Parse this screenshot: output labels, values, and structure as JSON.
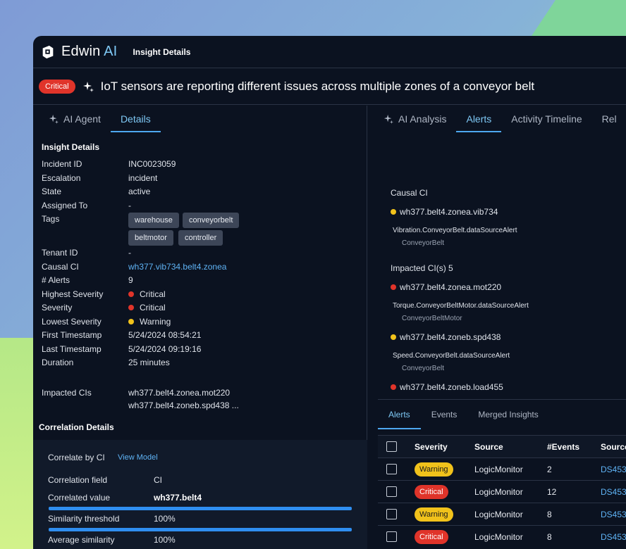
{
  "app": {
    "brand_prefix": "Edwin",
    "brand_suffix": "AI",
    "page_title": "Insight Details"
  },
  "headline": {
    "severity": "Critical",
    "text": "IoT sensors are reporting different issues across multiple zones of a conveyor belt"
  },
  "left_tabs": [
    "AI Agent",
    "Details"
  ],
  "details": {
    "section_title": "Insight Details",
    "incident_id_label": "Incident ID",
    "incident_id": "INC0023059",
    "escalation_label": "Escalation",
    "escalation": "incident",
    "state_label": "State",
    "state": "active",
    "assigned_label": "Assigned To",
    "assigned": "-",
    "tags_label": "Tags",
    "tags": [
      "warehouse",
      "conveyorbelt",
      "beltmotor",
      "controller"
    ],
    "tenant_label": "Tenant ID",
    "tenant": "-",
    "causal_ci_label": "Causal CI",
    "causal_ci": "wh377.vib734.belt4.zonea",
    "alerts_label": "# Alerts",
    "alerts": "9",
    "highest_sev_label": "Highest Severity",
    "highest_sev": "Critical",
    "severity_label": "Severity",
    "severity": "Critical",
    "lowest_sev_label": "Lowest Severity",
    "lowest_sev": "Warning",
    "first_ts_label": "First Timestamp",
    "first_ts": "5/24/2024 08:54:21",
    "last_ts_label": "Last Timestamp",
    "last_ts": "5/24/2024 09:19:16",
    "duration_label": "Duration",
    "duration": "25 minutes",
    "impacted_label": "Impacted CIs",
    "impacted_1": "wh377.belt4.zonea.mot220",
    "impacted_2": "wh377.belt4.zoneb.spd438 ..."
  },
  "correlation": {
    "section_title": "Correlation Details",
    "correlate_by": "Correlate by CI",
    "view_model": "View Model",
    "field_label": "Correlation field",
    "field": "CI",
    "value_label": "Correlated value",
    "value": "wh377.belt4",
    "sim_threshold_label": "Similarity threshold",
    "sim_threshold": "100%",
    "avg_sim_label": "Average similarity",
    "avg_sim": "100%"
  },
  "right_tabs": [
    "AI Analysis",
    "Alerts",
    "Activity Timeline",
    "Rel"
  ],
  "analysis": {
    "causal_label": "Causal CI",
    "causal_ci": "wh377.belt4.zonea.vib734",
    "causal_alert": "Vibration.ConveyorBelt.dataSourceAlert",
    "causal_type": "ConveyorBelt",
    "impacted_label": "Impacted CI(s) 5",
    "impacted": [
      {
        "ci": "wh377.belt4.zonea.mot220",
        "alert": "Torque.ConveyorBeltMotor.dataSourceAlert",
        "type": "ConveyorBeltMotor"
      },
      {
        "ci": "wh377.belt4.zoneb.spd438",
        "alert": "Speed.ConveyorBelt.dataSourceAlert",
        "type": "ConveyorBelt"
      },
      {
        "ci": "wh377.belt4.zoneb.load455"
      }
    ]
  },
  "alerts_panel": {
    "tabs": [
      "Alerts",
      "Events",
      "Merged Insights"
    ],
    "headers": [
      "Severity",
      "Source",
      "#Events",
      "Source"
    ],
    "rows": [
      {
        "severity": "Warning",
        "source": "LogicMonitor",
        "events": "2",
        "source2": "DS453"
      },
      {
        "severity": "Critical",
        "source": "LogicMonitor",
        "events": "12",
        "source2": "DS453"
      },
      {
        "severity": "Warning",
        "source": "LogicMonitor",
        "events": "8",
        "source2": "DS453"
      },
      {
        "severity": "Critical",
        "source": "LogicMonitor",
        "events": "8",
        "source2": "DS453"
      }
    ]
  },
  "colors": {
    "critical": "#e0342a",
    "warning": "#f1c21b",
    "accent": "#4ea8f0",
    "panel_bg": "#0b1220"
  }
}
